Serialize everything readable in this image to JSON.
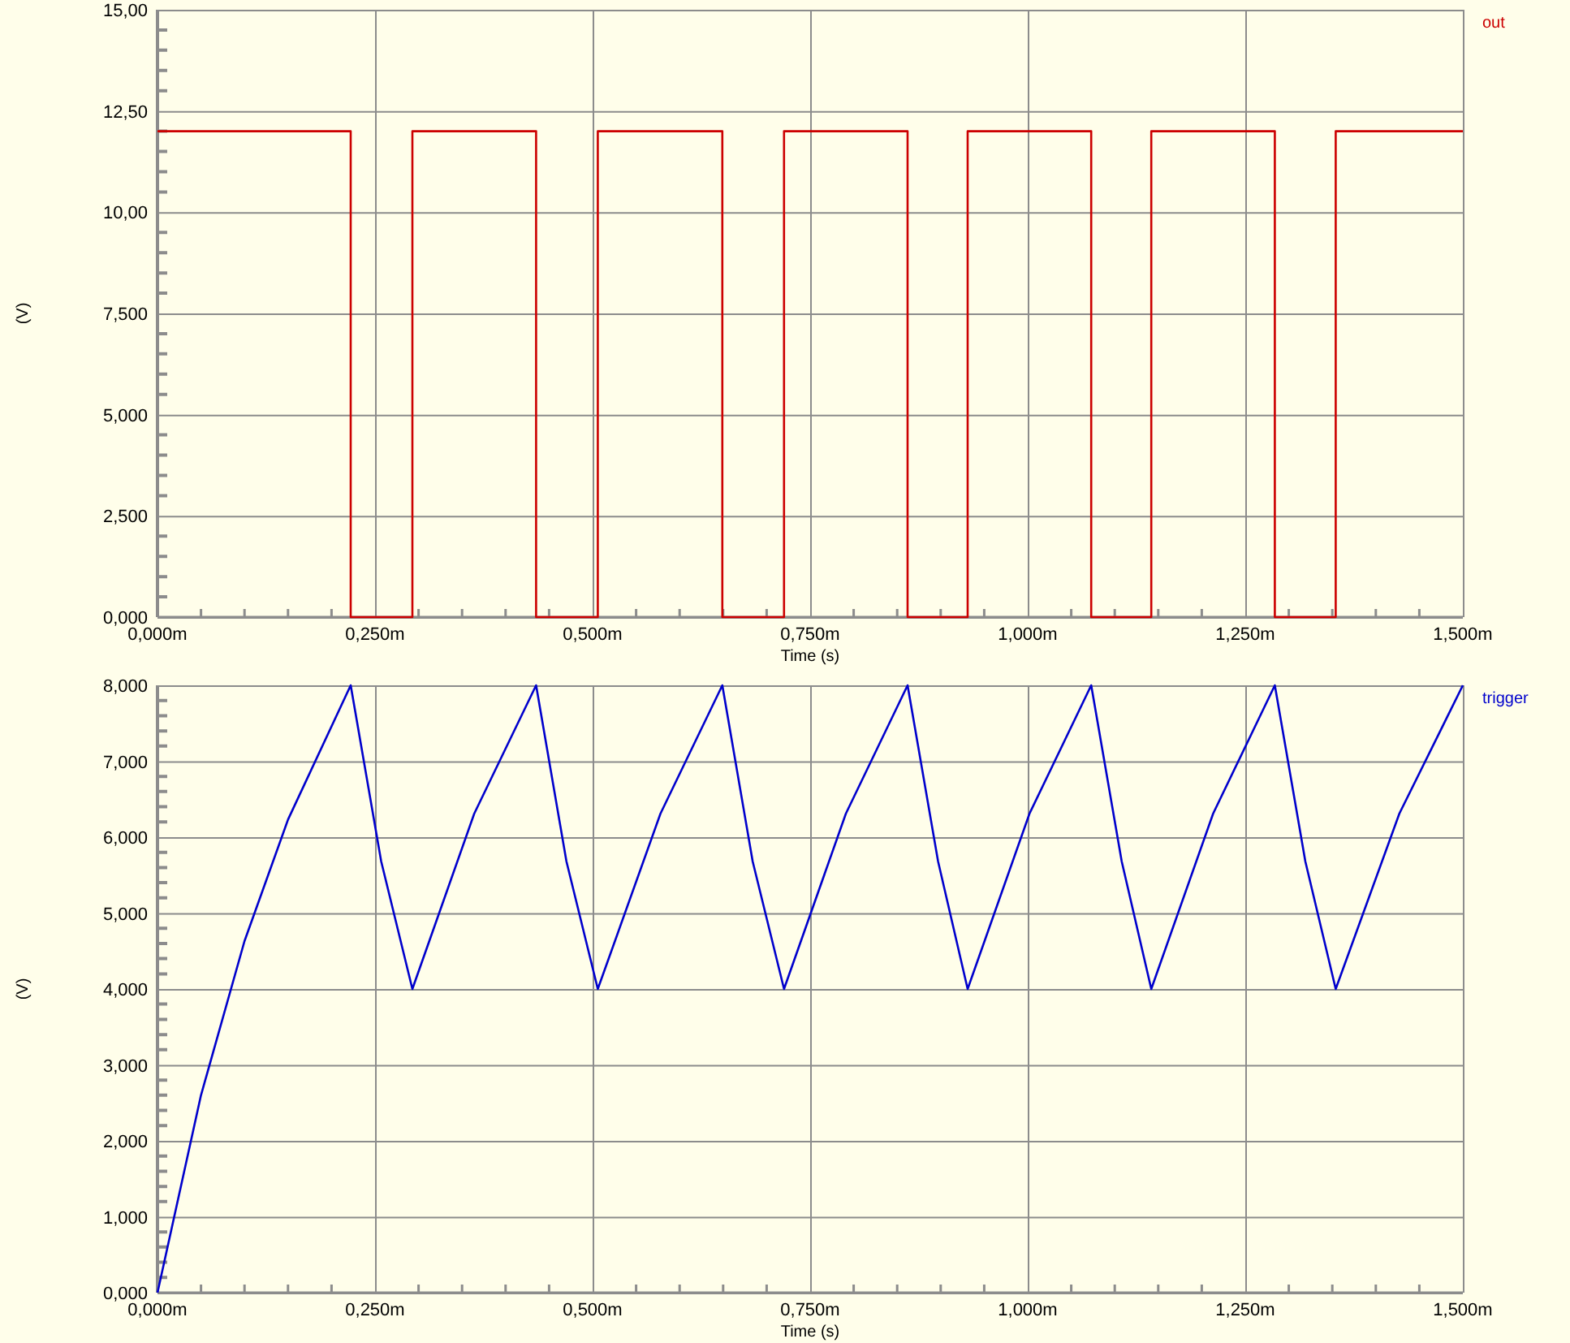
{
  "charts": [
    {
      "chart_data": {
        "type": "line",
        "grid": true,
        "xlabel": "Time (s)",
        "ylabel": "(V)",
        "xlim": [
          0,
          1.5
        ],
        "ylim": [
          0,
          15
        ],
        "x": [
          0,
          0.222,
          0.222,
          0.293,
          0.293,
          0.435,
          0.435,
          0.506,
          0.506,
          0.649,
          0.649,
          0.72,
          0.72,
          0.862,
          0.862,
          0.931,
          0.931,
          1.073,
          1.073,
          1.142,
          1.142,
          1.284,
          1.284,
          1.354,
          1.354,
          1.5
        ],
        "series": [
          {
            "name": "out",
            "color": "#cc0000",
            "values": [
              12,
              12,
              0,
              0,
              12,
              12,
              0,
              0,
              12,
              12,
              0,
              0,
              12,
              12,
              0,
              0,
              12,
              12,
              0,
              0,
              12,
              12,
              0,
              0,
              12,
              12
            ]
          }
        ],
        "xticks": [
          {
            "value": 0,
            "label": "0,000m"
          },
          {
            "value": 0.25,
            "label": "0,250m"
          },
          {
            "value": 0.5,
            "label": "0,500m"
          },
          {
            "value": 0.75,
            "label": "0,750m"
          },
          {
            "value": 1,
            "label": "1,000m"
          },
          {
            "value": 1.25,
            "label": "1,250m"
          },
          {
            "value": 1.5,
            "label": "1,500m"
          }
        ],
        "yticks": [
          {
            "value": 0,
            "label": "0,000"
          },
          {
            "value": 2.5,
            "label": "2,500"
          },
          {
            "value": 5,
            "label": "5,000"
          },
          {
            "value": 7.5,
            "label": "7,500"
          },
          {
            "value": 10,
            "label": "10,00"
          },
          {
            "value": 12.5,
            "label": "12,50"
          },
          {
            "value": 15,
            "label": "15,00"
          }
        ]
      }
    },
    {
      "chart_data": {
        "type": "line",
        "grid": true,
        "xlabel": "Time (s)",
        "ylabel": "(V)",
        "xlim": [
          0,
          1.5
        ],
        "ylim": [
          0,
          8
        ],
        "x": [
          0,
          0.05,
          0.1,
          0.15,
          0.222,
          0.257,
          0.293,
          0.364,
          0.435,
          0.47,
          0.506,
          0.578,
          0.649,
          0.684,
          0.72,
          0.791,
          0.862,
          0.897,
          0.931,
          1.002,
          1.073,
          1.108,
          1.142,
          1.213,
          1.284,
          1.319,
          1.354,
          1.427,
          1.5
        ],
        "series": [
          {
            "name": "trigger",
            "color": "#0000cc",
            "values": [
              0,
              2.6,
              4.63,
              6.23,
              8,
              5.68,
              4,
              6.31,
              8,
              5.68,
              4,
              6.31,
              8,
              5.68,
              4,
              6.31,
              8,
              5.68,
              4,
              6.31,
              8,
              5.68,
              4,
              6.31,
              8,
              5.68,
              4,
              6.31,
              8
            ]
          }
        ],
        "xticks": [
          {
            "value": 0,
            "label": "0,000m"
          },
          {
            "value": 0.25,
            "label": "0,250m"
          },
          {
            "value": 0.5,
            "label": "0,500m"
          },
          {
            "value": 0.75,
            "label": "0,750m"
          },
          {
            "value": 1,
            "label": "1,000m"
          },
          {
            "value": 1.25,
            "label": "1,250m"
          },
          {
            "value": 1.5,
            "label": "1,500m"
          }
        ],
        "yticks": [
          {
            "value": 0,
            "label": "0,000"
          },
          {
            "value": 1,
            "label": "1,000"
          },
          {
            "value": 2,
            "label": "2,000"
          },
          {
            "value": 3,
            "label": "3,000"
          },
          {
            "value": 4,
            "label": "4,000"
          },
          {
            "value": 5,
            "label": "5,000"
          },
          {
            "value": 6,
            "label": "6,000"
          },
          {
            "value": 7,
            "label": "7,000"
          },
          {
            "value": 8,
            "label": "8,000"
          }
        ]
      }
    }
  ]
}
